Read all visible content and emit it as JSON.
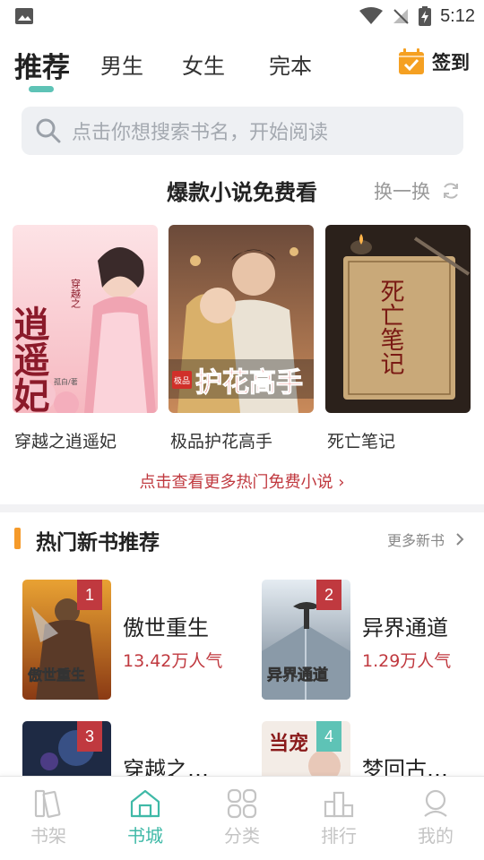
{
  "status_bar": {
    "time": "5:12"
  },
  "top_tabs": [
    {
      "label": "推荐",
      "active": true
    },
    {
      "label": "男生",
      "active": false
    },
    {
      "label": "女生",
      "active": false
    },
    {
      "label": "完本",
      "active": false
    }
  ],
  "checkin": {
    "label": "签到"
  },
  "search": {
    "placeholder": "点击你想搜索书名，开始阅读"
  },
  "hot_free": {
    "title": "爆款小说免费看",
    "refresh_label": "换一换",
    "books": [
      {
        "title": "穿越之逍遥妃",
        "cover_text": "逍遥妃",
        "cover_sub": "穿越之",
        "cover_author": "孤白/著"
      },
      {
        "title": "极品护花高手",
        "cover_text": "护花高手",
        "cover_sub": "极品"
      },
      {
        "title": "死亡笔记",
        "cover_text": "死亡笔记"
      }
    ],
    "more_link": "点击查看更多热门免费小说"
  },
  "new_books": {
    "title": "热门新书推荐",
    "more_label": "更多新书",
    "items": [
      {
        "rank": "1",
        "name": "傲世重生",
        "popularity": "13.42万人气",
        "cover_text": "傲世重生"
      },
      {
        "rank": "2",
        "name": "异界通道",
        "popularity": "1.29万人气",
        "cover_text": "异界通道"
      },
      {
        "rank": "3",
        "name": "穿越之…",
        "popularity": ""
      },
      {
        "rank": "4",
        "name": "梦回古…",
        "popularity": "",
        "cover_text": "当宠"
      }
    ]
  },
  "bottom_nav": [
    {
      "label": "书架",
      "icon": "bookshelf-icon",
      "active": false
    },
    {
      "label": "书城",
      "icon": "bookstore-icon",
      "active": true
    },
    {
      "label": "分类",
      "icon": "category-icon",
      "active": false
    },
    {
      "label": "排行",
      "icon": "ranking-icon",
      "active": false
    },
    {
      "label": "我的",
      "icon": "profile-icon",
      "active": false
    }
  ],
  "colors": {
    "accent_teal": "#3fb9a7",
    "price_red": "#c0393f",
    "section_orange": "#f59a2a",
    "checkin_orange": "#f5a022"
  }
}
